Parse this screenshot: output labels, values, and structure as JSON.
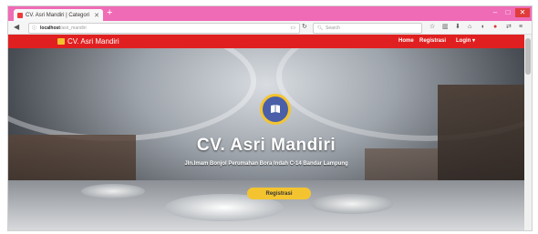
{
  "browser": {
    "tab_title": "CV. Asri Mandiri | Categori",
    "new_tab": "+",
    "window_controls": {
      "minimize": "–",
      "maximize": "□",
      "close": "✕"
    },
    "url_host": "localhost",
    "url_path": "/asri_mandiri",
    "search_placeholder": "Search",
    "icons": [
      "back-icon",
      "info-icon",
      "reader-icon",
      "reload-icon",
      "search-icon",
      "star-icon",
      "library-icon",
      "download-icon",
      "home-icon",
      "pocket-icon",
      "addon-icon",
      "sync-icon",
      "menu-icon"
    ]
  },
  "site": {
    "brand": "CV. Asri Mandiri",
    "nav": {
      "home": "Home",
      "registrasi": "Registrasi",
      "login": "Login ▾"
    },
    "hero": {
      "title": "CV. Asri Mandiri",
      "address": "Jln.Imam Bonjol Perumahan Bora Indah C-14 Bandar Lampung",
      "cta": "Registrasi"
    },
    "colors": {
      "navbar": "#e02020",
      "accent": "#f4c430",
      "tabbar": "#ef6bb6",
      "logo_circle": "#4a5fa8"
    }
  }
}
